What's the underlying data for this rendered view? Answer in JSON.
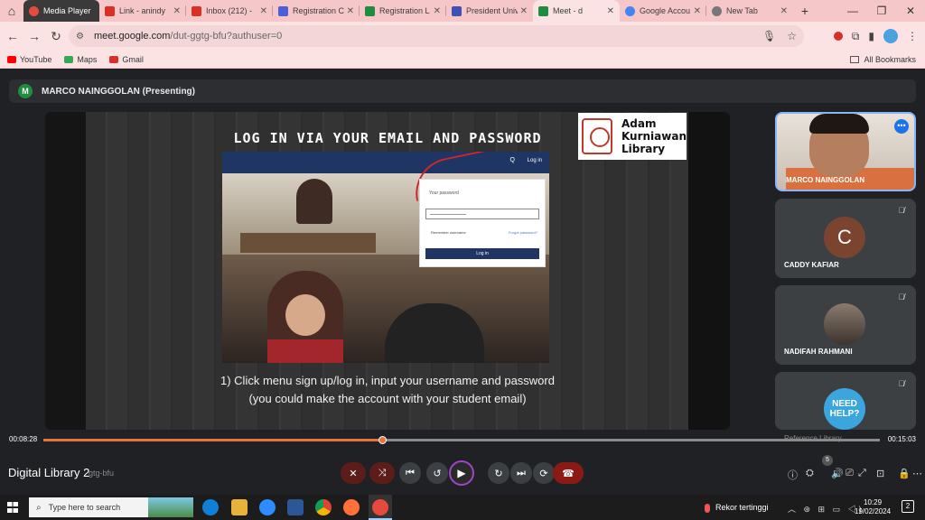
{
  "browser": {
    "tabs": [
      {
        "title": "Media Player",
        "favicon_color": "#e64a3c"
      },
      {
        "title": "Link - anindy",
        "favicon_color": "#d93025"
      },
      {
        "title": "Inbox (212) -",
        "favicon_color": "#d93025"
      },
      {
        "title": "Registration C",
        "favicon_color": "#4b5fd6"
      },
      {
        "title": "Registration L",
        "favicon_color": "#1e8e3e"
      },
      {
        "title": "President Univ",
        "favicon_color": "#3f51b5"
      },
      {
        "title": "Meet - d",
        "favicon_color": "#1e8e3e"
      },
      {
        "title": "Google Accou",
        "favicon_color": "#4285f4"
      },
      {
        "title": "New Tab",
        "favicon_color": "#777777"
      }
    ],
    "url_host": "meet.google.com",
    "url_path": "/dut-ggtg-bfu?authuser=0",
    "bookmarks": [
      {
        "label": "YouTube",
        "color": "#ff0000"
      },
      {
        "label": "Maps",
        "color": "#34a853"
      },
      {
        "label": "Gmail",
        "color": "#d93025"
      }
    ],
    "all_bookmarks": "All Bookmarks"
  },
  "meet": {
    "presenter_initial": "M",
    "presenter_label": "MARCO NAINGGOLAN (Presenting)",
    "slide": {
      "title": "LOG IN VIA YOUR EMAIL AND PASSWORD",
      "logo_lines": [
        "Adam",
        "Kurniawan",
        "Library"
      ],
      "caption_line1": "1) Click menu sign up/log in, input your username and password",
      "caption_line2": "(you could make the account with your student email)",
      "site_search": "Q",
      "site_login": "Log in",
      "form_label": "Your password",
      "remember": "Remember username",
      "forgot": "Forgot password?",
      "login_button": "Log in"
    },
    "participants": [
      {
        "name": "MARCO NAINGGOLAN"
      },
      {
        "name": "CADDY KAFIAR",
        "initial": "C"
      },
      {
        "name": "NADIFAH RAHMANI"
      },
      {
        "name": "Reference Library",
        "help_text": "NEED HELP?"
      }
    ]
  },
  "player": {
    "elapsed": "00:08:28",
    "total": "00:15:03",
    "progress": 0.405,
    "title": "Digital Library 2",
    "meeting_code": "gtg-bfu",
    "participant_count": "5"
  },
  "taskbar": {
    "search_placeholder": "Type here to search",
    "weather": "Rekor tertinggi",
    "time": "10:29",
    "date": "19/02/2024",
    "notifications": "2"
  },
  "colors": {
    "accent": "#e8743c",
    "tabstrip": "#f6c7c9"
  }
}
